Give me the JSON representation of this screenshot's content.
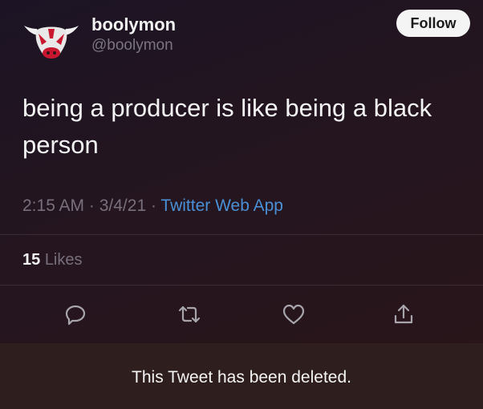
{
  "user": {
    "display_name": "boolymon",
    "handle": "@boolymon",
    "avatar_icon": "bull-head-icon"
  },
  "follow_label": "Follow",
  "tweet": {
    "text": "being a producer is like being a black person",
    "time": "2:15 AM",
    "separator": " · ",
    "date": "3/4/21",
    "source": "Twitter Web App"
  },
  "likes": {
    "count": "15",
    "label": "Likes"
  },
  "actions": {
    "reply_icon": "reply-icon",
    "retweet_icon": "retweet-icon",
    "like_icon": "heart-icon",
    "share_icon": "share-icon"
  },
  "banner": {
    "text": "This Tweet has been deleted."
  },
  "colors": {
    "link": "#4a90d6",
    "muted": "#77707c",
    "text": "#f4f4f4",
    "background": "#1c1424",
    "banner": "#2f1e1e"
  }
}
